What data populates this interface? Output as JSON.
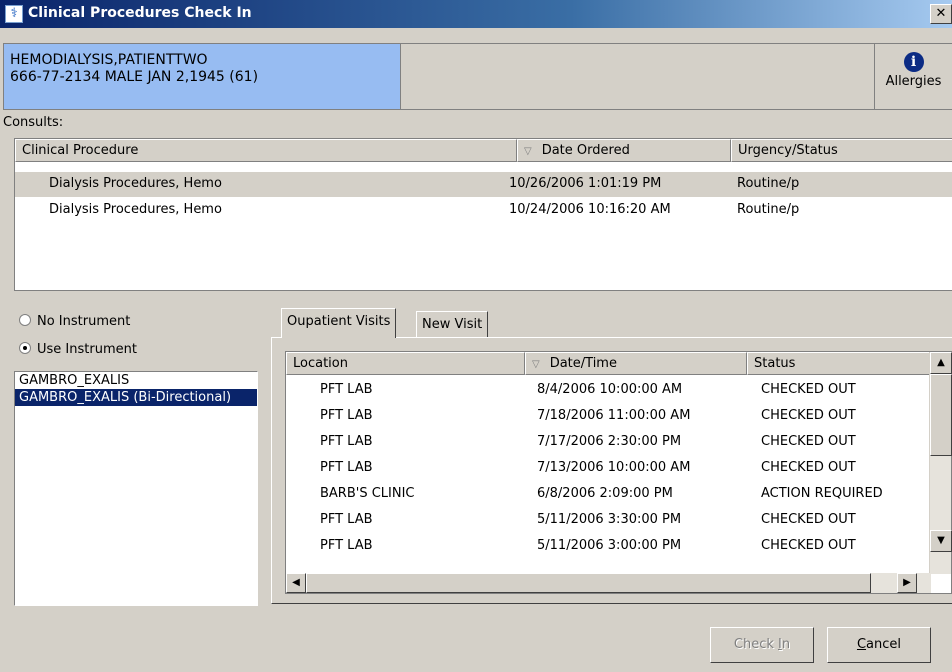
{
  "window": {
    "title": "Clinical Procedures Check In",
    "close_glyph": "✕"
  },
  "patient": {
    "name": "HEMODIALYSIS,PATIENTTWO",
    "details": "666-77-2134  MALE JAN 2,1945 (61)"
  },
  "allergies": {
    "label": "Allergies",
    "icon": "info-icon"
  },
  "consults": {
    "label": "Consults:",
    "columns": [
      "Clinical Procedure",
      "Date Ordered",
      "Urgency/Status"
    ],
    "rows": [
      {
        "procedure": "Dialysis Procedures, Hemo",
        "date": "10/26/2006 1:01:19 PM",
        "status": "Routine/p"
      },
      {
        "procedure": "Dialysis Procedures, Hemo",
        "date": "10/24/2006 10:16:20 AM",
        "status": "Routine/p"
      }
    ]
  },
  "instrument": {
    "no_instrument_label": "No Instrument",
    "use_instrument_label": "Use Instrument",
    "selected_option": "Use Instrument",
    "items": [
      "GAMBRO_EXALIS",
      "GAMBRO_EXALIS (Bi-Directional)"
    ],
    "selected_item": "GAMBRO_EXALIS (Bi-Directional)"
  },
  "tabs": [
    {
      "label": "Oupatient Visits",
      "active": true
    },
    {
      "label": "New Visit",
      "active": false
    }
  ],
  "visits": {
    "columns": [
      "Location",
      "Date/Time",
      "Status"
    ],
    "rows": [
      {
        "location": "PFT LAB",
        "datetime": "8/4/2006 10:00:00 AM",
        "status": "CHECKED OUT"
      },
      {
        "location": "PFT LAB",
        "datetime": "7/18/2006 11:00:00 AM",
        "status": "CHECKED OUT"
      },
      {
        "location": "PFT LAB",
        "datetime": "7/17/2006 2:30:00 PM",
        "status": "CHECKED OUT"
      },
      {
        "location": "PFT LAB",
        "datetime": "7/13/2006 10:00:00 AM",
        "status": "CHECKED OUT"
      },
      {
        "location": "BARB'S CLINIC",
        "datetime": "6/8/2006 2:09:00 PM",
        "status": "ACTION REQUIRED"
      },
      {
        "location": "PFT LAB",
        "datetime": "5/11/2006 3:30:00 PM",
        "status": "CHECKED OUT"
      },
      {
        "location": "PFT LAB",
        "datetime": "5/11/2006 3:00:00 PM",
        "status": "CHECKED OUT"
      }
    ]
  },
  "buttons": {
    "check_in": {
      "prefix": "Check ",
      "accel": "I",
      "suffix": "n"
    },
    "cancel": {
      "prefix": "",
      "accel": "C",
      "suffix": "ancel"
    }
  }
}
